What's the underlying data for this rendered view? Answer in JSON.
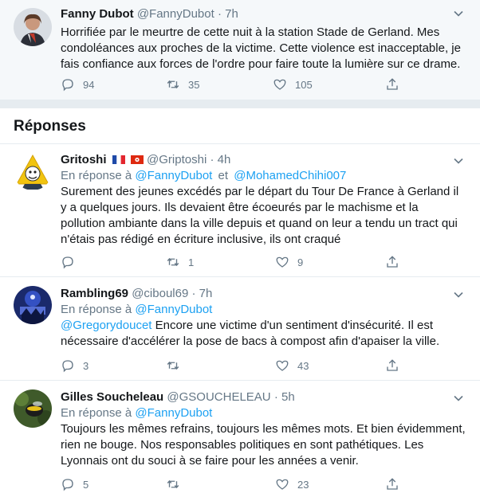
{
  "main_tweet": {
    "name": "Fanny Dubot",
    "handle": "@FannyDubot",
    "time": "7h",
    "text": "Horrifiée par le meurtre de cette nuit à la station Stade de Gerland. Mes condoléances aux proches de la victime. Cette violence est inacceptable, je fais confiance aux forces de l'ordre pour faire toute la lumière sur ce drame.",
    "replies": "94",
    "retweets": "35",
    "likes": "105"
  },
  "section": {
    "title": "Réponses"
  },
  "replies": [
    {
      "name": "Gritoshi",
      "handle": "@Griptoshi",
      "time": "4h",
      "reply_prefix": "En réponse à",
      "reply_to_1": "@FannyDubot",
      "reply_and": "et",
      "reply_to_2": "@MohamedChihi007",
      "text": "Surement des jeunes excédés par le départ du Tour De France à Gerland il y a quelques jours. Ils devaient être écoeurés par le machisme et la pollution ambiante dans la ville depuis et quand on leur a tendu un tract qui n'étais pas rédigé en écriture inclusive, ils ont craqué",
      "replies": "",
      "retweets": "1",
      "likes": "9"
    },
    {
      "name": "Rambling69",
      "handle": "@ciboul69",
      "time": "7h",
      "reply_prefix": "En réponse à",
      "reply_to_1": "@FannyDubot",
      "mention": "@Gregorydoucet",
      "text": " Encore une victime d'un sentiment d'insécurité. Il est nécessaire d'accélérer la pose de bacs à compost afin d'apaiser la ville.",
      "replies": "3",
      "retweets": "",
      "likes": "43"
    },
    {
      "name": "Gilles Soucheleau",
      "handle": "@GSOUCHELEAU",
      "time": "5h",
      "reply_prefix": "En réponse à",
      "reply_to_1": "@FannyDubot",
      "text": "Toujours les mêmes refrains, toujours les mêmes mots. Et bien évidemment, rien ne bouge. Nos responsables politiques en sont pathétiques. Les Lyonnais ont du souci à se faire pour les années a venir.",
      "replies": "5",
      "retweets": "",
      "likes": "23"
    }
  ],
  "colors": {
    "link": "#1da1f2",
    "muted": "#657786",
    "text": "#14171a",
    "bg_main": "#f5f8fa",
    "separator": "#e6ecf0"
  },
  "icons": [
    "reply-icon",
    "retweet-icon",
    "like-icon",
    "share-icon",
    "chevron-down-icon"
  ]
}
